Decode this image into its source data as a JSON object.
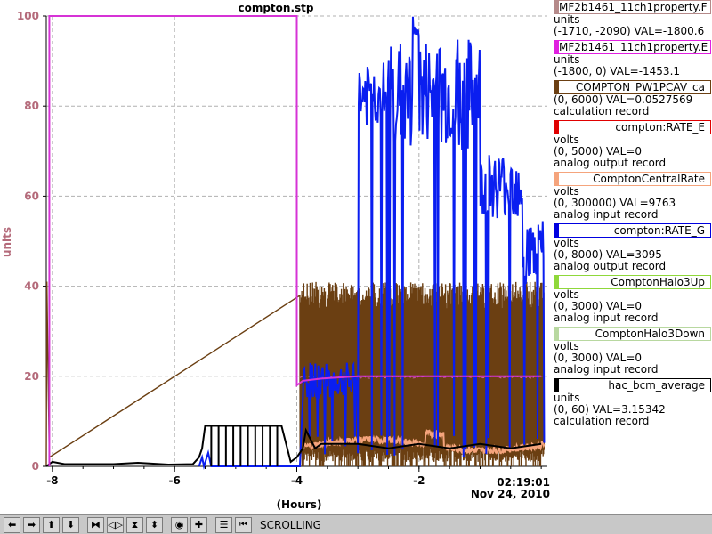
{
  "window": {
    "title": "compton.stp"
  },
  "plot": {
    "y_axis_label": "units",
    "x_axis_label": "(Hours)",
    "timestamp_time": "02:19:01",
    "timestamp_date": "Nov 24, 2010",
    "colors": {
      "magenta": "#d633d6",
      "brown": "#6b3f12",
      "blue": "#0a1ef0",
      "salmon": "#f5a47c",
      "black": "#000000",
      "pink_trace": "#cc5fa4",
      "axis_label": "#b46a7a"
    }
  },
  "chart_data": {
    "type": "line",
    "title": "compton.stp",
    "xlabel": "(Hours)",
    "ylabel": "units",
    "xlim": [
      -8.1,
      0.1
    ],
    "ylim": [
      0,
      100
    ],
    "grid": true,
    "x_ticks": [
      "-8",
      "-6",
      "-4",
      "-2"
    ],
    "x_tick_values": [
      -8,
      -6,
      -4,
      -2
    ],
    "y_ticks": [
      "0",
      "20",
      "40",
      "60",
      "80",
      "100"
    ],
    "y_tick_values": [
      0,
      20,
      40,
      60,
      80,
      100
    ],
    "series": [
      {
        "name": "MF2b1461_11ch1property.E",
        "color": "#d633d6",
        "x": [
          -8.05,
          -8.05,
          -4.0,
          -4.0,
          -3.9,
          -3.6,
          -3.0,
          -2.0,
          -1.0,
          0.0
        ],
        "y": [
          0,
          100,
          100,
          18,
          19,
          19.5,
          20,
          20,
          20,
          20
        ]
      },
      {
        "name": "hac_bcm_average",
        "color": "#000000",
        "x": [
          -8.1,
          -8.0,
          -7.8,
          -7.0,
          -6.6,
          -6.1,
          -5.7,
          -5.6,
          -5.55,
          -5.5,
          -5.3,
          -5.0,
          -4.5,
          -4.3,
          -4.25,
          -4.1,
          -4.0,
          -3.9,
          -3.85,
          -3.7,
          -3.6,
          -3.0,
          -2.5,
          -2.0,
          -1.5,
          -1.0,
          -0.5,
          0.0
        ],
        "y": [
          0,
          1,
          0.5,
          0.5,
          0.8,
          0.4,
          0.5,
          2,
          4,
          9,
          9,
          9,
          9,
          9,
          9,
          1,
          2,
          4,
          8,
          4,
          5,
          5,
          4,
          5,
          4,
          5,
          4,
          5
        ]
      },
      {
        "name": "ComptonCentralRate",
        "color": "#f5a47c",
        "x": [
          -4.0,
          -3.5,
          -3.0,
          -2.5,
          -2.0,
          -1.8,
          -1.5,
          -1.0,
          -0.5,
          0.0
        ],
        "y": [
          1,
          3,
          5,
          5,
          6,
          7,
          5,
          4,
          3,
          4
        ]
      }
    ]
  },
  "legend": [
    {
      "name": "MF2b1461_11ch1property.F",
      "color": "#b58a8a",
      "lines": [
        "units",
        "(-1710, -2090) VAL=-1800.6"
      ]
    },
    {
      "name": "MF2b1461_11ch1property.E",
      "color": "#e020e0",
      "lines": [
        "units",
        "(-1800, 0) VAL=-1453.1"
      ]
    },
    {
      "name": "COMPTON_PW1PCAV_ca",
      "color": "#6b3f12",
      "lines": [
        "(0, 6000) VAL=0.0527569",
        "calculation record"
      ]
    },
    {
      "name": "compton:RATE_E",
      "color": "#e00000",
      "lines": [
        "volts",
        "(0, 5000) VAL=0",
        "analog output record"
      ]
    },
    {
      "name": "ComptonCentralRate",
      "color": "#f5a47c",
      "lines": [
        "volts",
        "(0, 300000) VAL=9763",
        "analog input record"
      ]
    },
    {
      "name": "compton:RATE_G",
      "color": "#0000e0",
      "lines": [
        "volts",
        "(0, 8000) VAL=3095",
        "analog output record"
      ]
    },
    {
      "name": "ComptonHalo3Up",
      "color": "#8fd83a",
      "lines": [
        "volts",
        "(0, 3000) VAL=0",
        "analog input record"
      ]
    },
    {
      "name": "ComptonHalo3Down",
      "color": "#b8d8a0",
      "lines": [
        "volts",
        "(0, 3000) VAL=0",
        "analog input record"
      ]
    },
    {
      "name": "hac_bcm_average",
      "color": "#000000",
      "lines": [
        "units",
        "(0, 60) VAL=3.15342",
        "calculation record"
      ]
    }
  ],
  "toolbar": {
    "buttons": [
      {
        "name": "scroll-left-button",
        "icon": "arrow-left-icon",
        "glyph": "➡"
      },
      {
        "name": "scroll-right-button",
        "icon": "arrow-right-icon",
        "glyph": "➡"
      },
      {
        "name": "scroll-up-button",
        "icon": "arrow-up-icon",
        "glyph": "⬆"
      },
      {
        "name": "scroll-down-button",
        "icon": "arrow-down-icon",
        "glyph": "⬇"
      },
      {
        "name": "zoom-in-horizontal-button",
        "icon": "zoom-in-horizontal-icon",
        "glyph": "⧓"
      },
      {
        "name": "zoom-out-horizontal-button",
        "icon": "zoom-out-horizontal-icon",
        "glyph": "◁▷"
      },
      {
        "name": "zoom-in-vertical-button",
        "icon": "zoom-in-vertical-icon",
        "glyph": "⧗"
      },
      {
        "name": "zoom-out-vertical-button",
        "icon": "zoom-out-vertical-icon",
        "glyph": "⬍"
      },
      {
        "name": "autoscale-button",
        "icon": "target-icon",
        "glyph": "◉"
      },
      {
        "name": "reset-button",
        "icon": "plus-icon",
        "glyph": "✚"
      },
      {
        "name": "toggle-scroll-button",
        "icon": "scroll-toggle-icon",
        "glyph": "☰"
      },
      {
        "name": "scroll-to-now-button",
        "icon": "jump-back-icon",
        "glyph": "⏮"
      }
    ],
    "status": "SCROLLING"
  }
}
